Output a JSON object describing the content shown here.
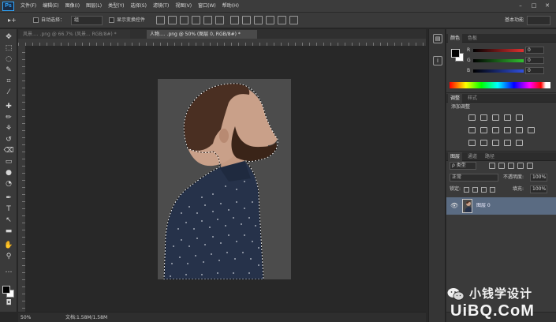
{
  "app": {
    "logo": "Ps"
  },
  "menu": {
    "items": [
      "文件(F)",
      "编辑(E)",
      "图像(I)",
      "图层(L)",
      "类型(Y)",
      "选择(S)",
      "滤镜(T)",
      "视图(V)",
      "窗口(W)",
      "帮助(H)"
    ]
  },
  "window_controls": {
    "minimize": "–",
    "maximize": "□",
    "close": "✕"
  },
  "options": {
    "tool_glyph": "▸+",
    "auto_select_label": "自动选择：",
    "auto_select_value": "组",
    "show_transform_label": "显示变换控件",
    "workspace": "基本功能"
  },
  "tabs": [
    {
      "label": "风景.... .png @ 66.7% (风景... RGB/8#) *",
      "active": false
    },
    {
      "label": "人物.... .png @ 50% (图层 0, RGB/8#) *",
      "active": true
    }
  ],
  "status": {
    "zoom": "50%",
    "doc": "文档:1.58M/1.58M"
  },
  "color_panel": {
    "tabs": [
      "颜色",
      "色板"
    ],
    "sliders": [
      {
        "label": "R",
        "value": "0",
        "color": "#e03030"
      },
      {
        "label": "G",
        "value": "0",
        "color": "#30c030"
      },
      {
        "label": "B",
        "value": "0",
        "color": "#3050e0"
      }
    ]
  },
  "adjust_panel": {
    "tabs": [
      "调整",
      "样式"
    ],
    "title": "添加调整"
  },
  "layers_panel": {
    "tabs": [
      "图层",
      "通道",
      "路径"
    ],
    "filter": "ρ 类型",
    "blend_mode": "正常",
    "opacity_label": "不透明度:",
    "opacity": "100%",
    "lock_label": "锁定:",
    "fill_label": "填充:",
    "fill": "100%",
    "layers": [
      {
        "name": "图层 0",
        "visible": true,
        "selected": true
      }
    ]
  },
  "watermark": {
    "cn": "小钱学设计",
    "en": "UiBQ.CoM"
  }
}
